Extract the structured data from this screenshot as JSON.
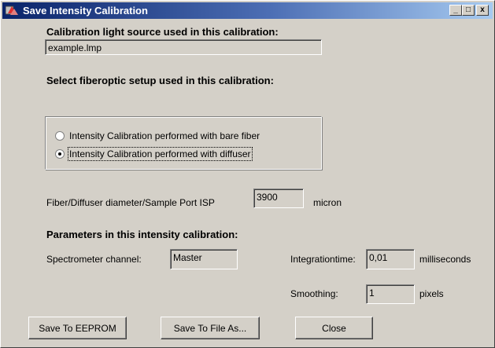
{
  "window": {
    "title": "Save Intensity Calibration",
    "minimize_glyph": "_",
    "maximize_glyph": "□",
    "close_glyph": "x"
  },
  "light_source": {
    "label": "Calibration light source used in this calibration:",
    "value": "example.lmp"
  },
  "fiberoptic": {
    "label": "Select  fiberoptic setup used in this calibration:",
    "options": [
      {
        "label": "Intensity Calibration performed with bare fiber",
        "selected": false
      },
      {
        "label": "Intensity Calibration performed with diffuser",
        "selected": true
      }
    ]
  },
  "diameter": {
    "label": "Fiber/Diffuser diameter/Sample Port ISP",
    "value": "3900",
    "unit": "micron"
  },
  "parameters": {
    "heading": "Parameters in this intensity calibration:",
    "channel_label": "Spectrometer channel:",
    "channel_value": "Master",
    "integration_label": "Integrationtime:",
    "integration_value": "0,01",
    "integration_unit": "milliseconds",
    "smoothing_label": "Smoothing:",
    "smoothing_value": "1",
    "smoothing_unit": "pixels"
  },
  "buttons": {
    "save_eeprom": "Save To EEPROM",
    "save_file": "Save To File As...",
    "close": "Close"
  },
  "icons": {
    "app_icon": "calibration-app-icon"
  }
}
